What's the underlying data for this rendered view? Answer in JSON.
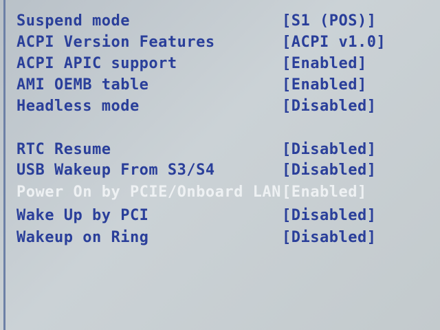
{
  "bios_settings": [
    {
      "label": "Suspend mode",
      "value": "[S1 (POS)]"
    },
    {
      "label": "ACPI Version Features",
      "value": "[ACPI v1.0]"
    },
    {
      "label": "ACPI APIC support",
      "value": "[Enabled]"
    },
    {
      "label": "AMI OEMB table",
      "value": "[Enabled]"
    },
    {
      "label": "Headless mode",
      "value": "[Disabled]"
    },
    {
      "label": "RTC Resume",
      "value": "[Disabled]"
    },
    {
      "label": "USB Wakeup From S3/S4",
      "value": "[Disabled]"
    },
    {
      "label": "Power On by PCIE/Onboard LAN",
      "value": "[Enabled]",
      "highlighted": true
    },
    {
      "label": "Wake Up by PCI",
      "value": "[Disabled]"
    },
    {
      "label": "Wakeup on Ring",
      "value": "[Disabled]"
    }
  ],
  "colors": {
    "background": "#c6cdd2",
    "item_text": "#2a3f9a",
    "highlighted_text": "#eef1f3",
    "left_border": "#6c80a6"
  }
}
